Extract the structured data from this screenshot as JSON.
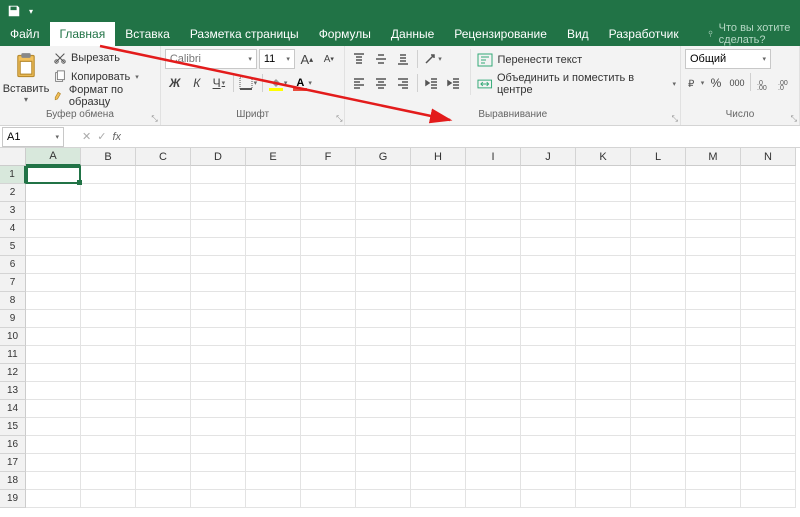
{
  "titlebar": {
    "save_icon": "save",
    "dropdown": "▾"
  },
  "tabs": {
    "file": "Файл",
    "items": [
      "Главная",
      "Вставка",
      "Разметка страницы",
      "Формулы",
      "Данные",
      "Рецензирование",
      "Вид",
      "Разработчик"
    ],
    "active_index": 0,
    "tell_me": "Что вы хотите сделать?"
  },
  "ribbon": {
    "clipboard": {
      "paste": "Вставить",
      "cut": "Вырезать",
      "copy": "Копировать",
      "format_painter": "Формат по образцу",
      "label": "Буфер обмена"
    },
    "font": {
      "name": "Calibri",
      "size": "11",
      "increase": "A",
      "decrease": "A",
      "bold": "Ж",
      "italic": "К",
      "underline": "Ч",
      "label": "Шрифт"
    },
    "alignment": {
      "wrap": "Перенести текст",
      "merge": "Объединить и поместить в центре",
      "label": "Выравнивание"
    },
    "number": {
      "format": "Общий",
      "label": "Число"
    }
  },
  "formula_bar": {
    "name_box": "A1",
    "cancel": "✕",
    "enter": "✓",
    "fx": "fx"
  },
  "grid": {
    "columns": [
      "A",
      "B",
      "C",
      "D",
      "E",
      "F",
      "G",
      "H",
      "I",
      "J",
      "K",
      "L",
      "M",
      "N"
    ],
    "rows": [
      "1",
      "2",
      "3",
      "4",
      "5",
      "6",
      "7",
      "8",
      "9",
      "10",
      "11",
      "12",
      "13",
      "14",
      "15",
      "16",
      "17",
      "18",
      "19"
    ],
    "active": "A1"
  },
  "glyphs": {
    "dd": "▾",
    "launcher": "⤡"
  }
}
